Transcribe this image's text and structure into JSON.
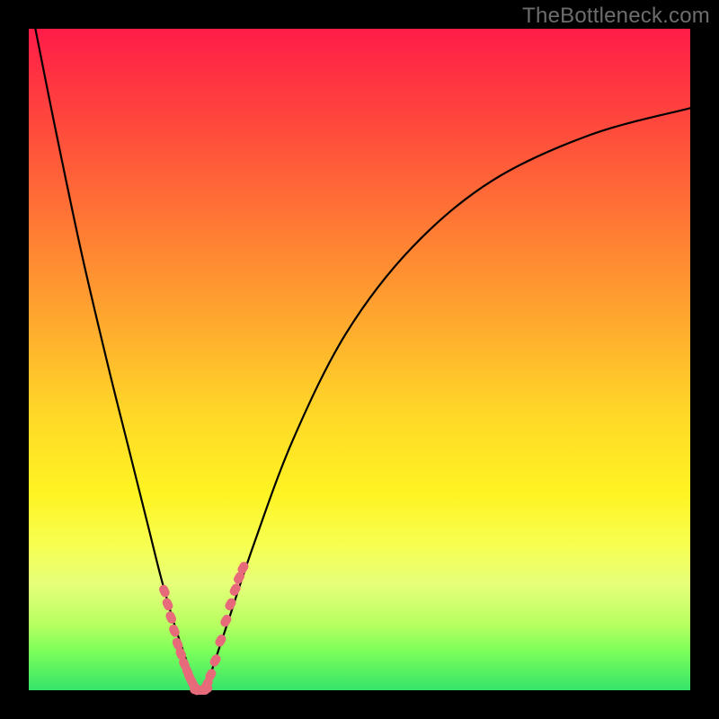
{
  "watermark": "TheBottleneck.com",
  "colors": {
    "frame": "#000000",
    "curve": "#000000",
    "markers": "#e76a7a",
    "gradient_stops": [
      "#ff1c48",
      "#ff4a3c",
      "#ff7a34",
      "#ffab2e",
      "#ffd728",
      "#fff322",
      "#f7ff50",
      "#e6ff7a",
      "#b8ff60",
      "#7dff5a",
      "#35e46a"
    ]
  },
  "chart_data": {
    "type": "line",
    "title": "",
    "xlabel": "",
    "ylabel": "",
    "xlim": [
      0,
      100
    ],
    "ylim": [
      0,
      100
    ],
    "grid": false,
    "legend": false,
    "series": [
      {
        "name": "bottleneck-curve",
        "x": [
          1,
          4,
          8,
          12,
          15,
          18,
          20,
          22,
          24,
          25,
          26,
          27,
          28,
          30,
          34,
          40,
          48,
          58,
          70,
          85,
          100
        ],
        "y": [
          100,
          85,
          66,
          49,
          37,
          25,
          17,
          10,
          4,
          1,
          0,
          1,
          4,
          10,
          22,
          38,
          54,
          67,
          77,
          84,
          88
        ]
      }
    ],
    "markers": [
      {
        "name": "left-cluster",
        "x": [
          20.5,
          21,
          21.5,
          22,
          22.5,
          23,
          23.5,
          24,
          24.3,
          24.7,
          25,
          25.3
        ],
        "y": [
          15,
          13,
          11,
          9,
          7,
          5.5,
          4,
          2.8,
          2,
          1.2,
          0.6,
          0.2
        ]
      },
      {
        "name": "right-cluster",
        "x": [
          27,
          27.5,
          28.2,
          29,
          29.8,
          30.5,
          31.2,
          31.8,
          32.4
        ],
        "y": [
          1,
          2.3,
          4.5,
          7.5,
          10.5,
          13,
          15.2,
          17,
          18.5
        ]
      },
      {
        "name": "bottom-cluster",
        "x": [
          25.3,
          25.7,
          26,
          26.4,
          26.8
        ],
        "y": [
          0.1,
          0,
          0,
          0,
          0.3
        ]
      }
    ]
  }
}
